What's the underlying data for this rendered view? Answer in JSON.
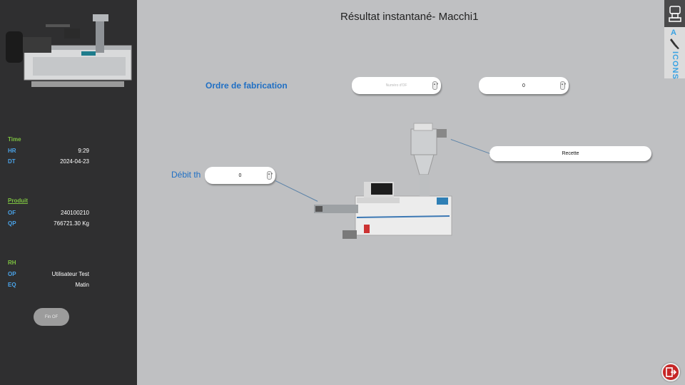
{
  "title": "Résultat instantané- Macchi1",
  "sidebar": {
    "time_section": "Time",
    "hr_label": "HR",
    "hr_value": "9:29",
    "dt_label": "DT",
    "dt_value": "2024-04-23",
    "produit_section": "Produit",
    "of_label": "OF",
    "of_value": "240100210",
    "qp_label": "QP",
    "qp_value": "766721.30 Kg",
    "rh_section": "RH",
    "op_label": "OP",
    "op_value": "Utilisateur Test",
    "eq_label": "EQ",
    "eq_value": "Matin",
    "fin_of_button": "Fin OF"
  },
  "main": {
    "ordre_label": "Ordre de fabrication",
    "numero_placeholder": "Numéro d'OF",
    "ordre_value": "0",
    "debit_label": "Débit th",
    "debit_value": "0",
    "recette_label": "Recette"
  },
  "right_panel": {
    "icons_label": "ICONS",
    "a_label": "A"
  },
  "colors": {
    "sidebar_bg": "#2f2f30",
    "main_bg": "#bfc0c2",
    "accent_blue": "#1f6fc4",
    "section_green": "#7dc241"
  }
}
